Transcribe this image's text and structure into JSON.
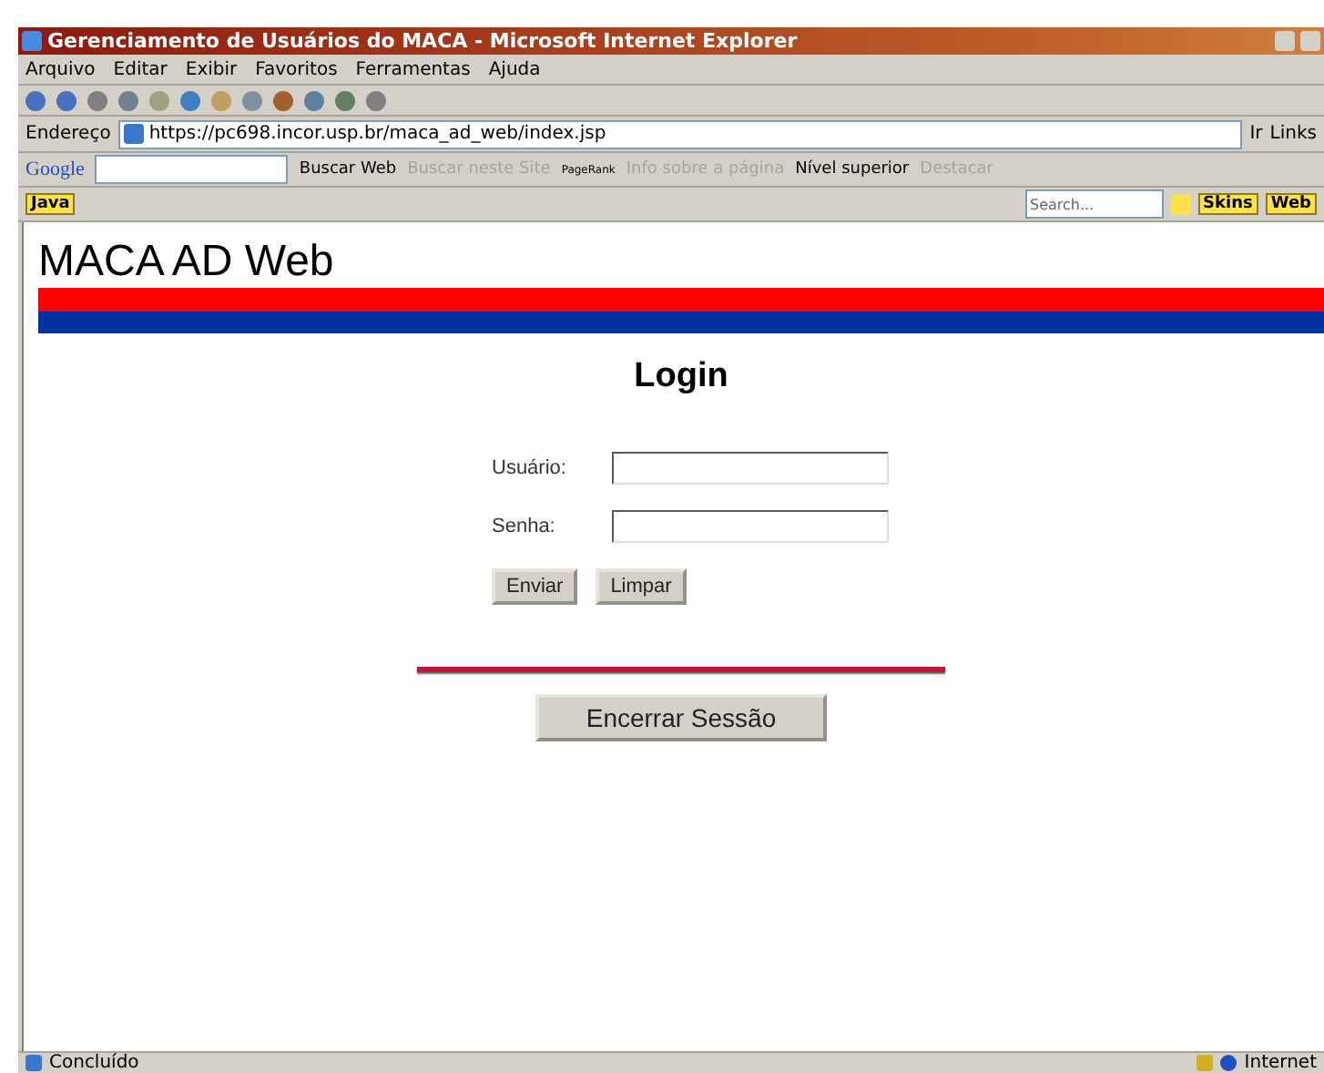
{
  "window": {
    "title": "Gerenciamento de Usuários do MACA - Microsoft Internet Explorer"
  },
  "menu": [
    "Arquivo",
    "Editar",
    "Exibir",
    "Favoritos",
    "Ferramentas",
    "Ajuda"
  ],
  "address": {
    "label": "Endereço",
    "url": "https://pc698.incor.usp.br/maca_ad_web/index.jsp",
    "go": "Ir",
    "links": "Links"
  },
  "google_bar": {
    "logo": "Google",
    "items": [
      {
        "label": "Buscar Web",
        "disabled": false
      },
      {
        "label": "Buscar neste Site",
        "disabled": true
      },
      {
        "label": "PageRank",
        "disabled": false
      },
      {
        "label": "Info sobre a página",
        "disabled": true
      },
      {
        "label": "Nível superior",
        "disabled": false
      },
      {
        "label": "Destacar",
        "disabled": true
      }
    ]
  },
  "java_bar": {
    "java": "Java",
    "search_placeholder": "Search...",
    "skins": "Skins",
    "web": "Web"
  },
  "page": {
    "logo": "MACA AD Web",
    "heading": "Login",
    "fields": [
      {
        "label": "Usuário:"
      },
      {
        "label": "Senha:"
      }
    ],
    "buttons": [
      "Enviar",
      "Limpar"
    ],
    "logout": "Encerrar Sessão"
  },
  "status_bar": {
    "text": "Concluído",
    "zone": "Internet"
  }
}
